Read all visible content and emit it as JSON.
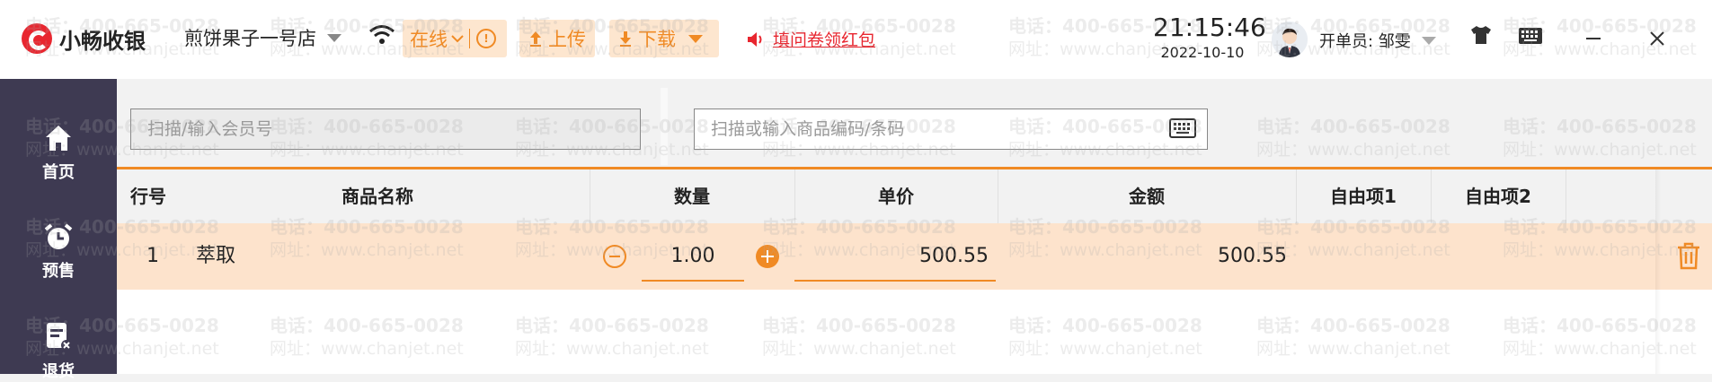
{
  "watermark": {
    "line1": "电话：400-665-0028",
    "line2": "网址：www.chanjet.net"
  },
  "topbar": {
    "logo_text": "小畅收银",
    "store_name": "煎饼果子一号店",
    "online_label": "在线",
    "upload_label": "上传",
    "download_label": "下载",
    "redpack_link": "填问卷领红包",
    "time": "21:15:46",
    "date": "2022-10-10",
    "cashier": "开单员: 邹雯"
  },
  "sidebar": {
    "items": [
      {
        "label": "首页",
        "icon": "home-icon"
      },
      {
        "label": "预售",
        "icon": "alarm-clock-icon"
      },
      {
        "label": "退货",
        "icon": "return-doc-icon"
      }
    ]
  },
  "search": {
    "member_placeholder": "扫描/输入会员号",
    "goods_placeholder": "扫描或输入商品编码/条码"
  },
  "table": {
    "headers": {
      "row_no": "行号",
      "name": "商品名称",
      "qty": "数量",
      "price": "单价",
      "amount": "金额",
      "custom1": "自由项1",
      "custom2": "自由项2"
    },
    "rows": [
      {
        "row_no": "1",
        "name": "萃取",
        "qty": "1.00",
        "price": "500.55",
        "amount": "500.55"
      }
    ]
  },
  "colors": {
    "accent": "#f08a24",
    "accent_bg": "#fde6cf",
    "sidebar": "#3e3a52",
    "brand_red": "#e8262f"
  }
}
